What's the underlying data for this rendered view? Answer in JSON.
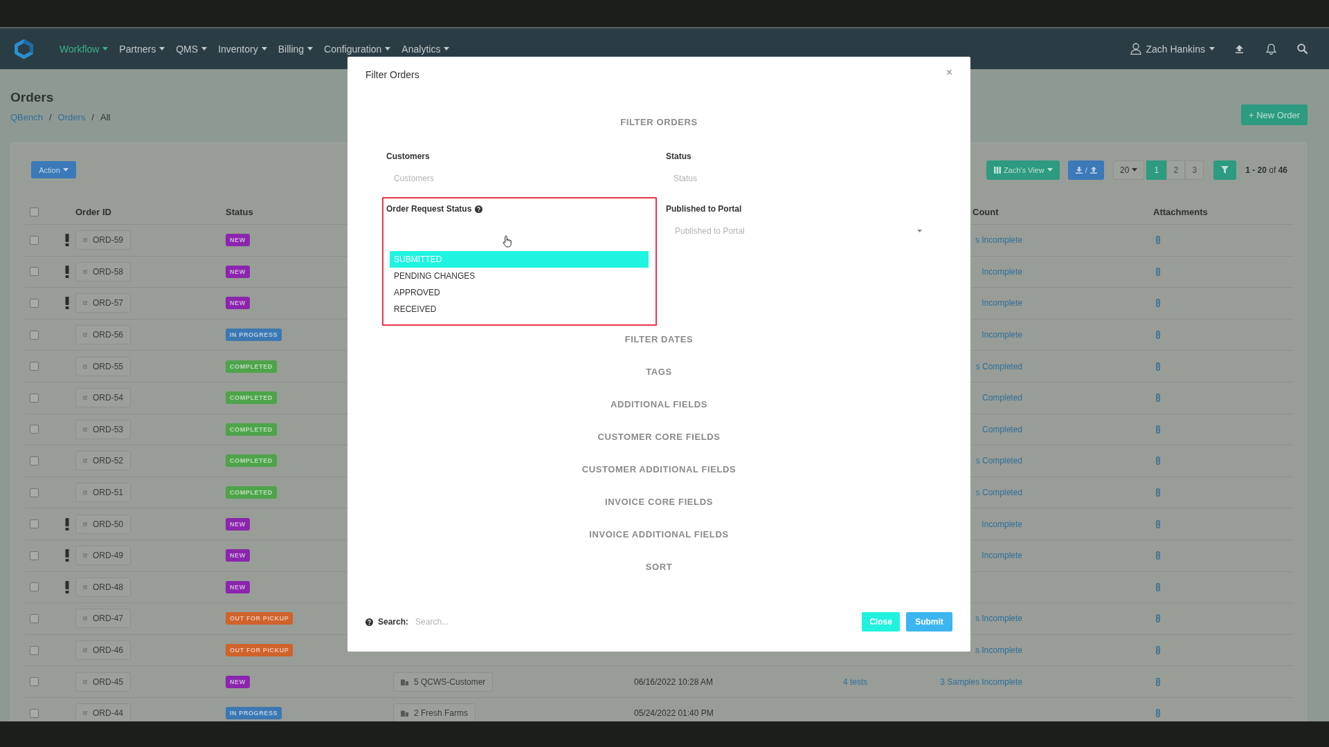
{
  "nav": {
    "items": [
      {
        "label": "Workflow",
        "selected": true
      },
      {
        "label": "Partners",
        "selected": false
      },
      {
        "label": "QMS",
        "selected": false
      },
      {
        "label": "Inventory",
        "selected": false
      },
      {
        "label": "Billing",
        "selected": false
      },
      {
        "label": "Configuration",
        "selected": false
      },
      {
        "label": "Analytics",
        "selected": false
      }
    ],
    "user": "Zach Hankins"
  },
  "header": {
    "title": "Orders",
    "breadcrumb": [
      {
        "kind": "link",
        "label": "QBench"
      },
      {
        "kind": "separator",
        "label": "/"
      },
      {
        "kind": "link",
        "label": "Orders"
      },
      {
        "kind": "separator",
        "label": "/"
      },
      {
        "kind": "current",
        "label": "All"
      }
    ],
    "new_button": "+ New Order"
  },
  "toolbar": {
    "action": "Action",
    "view": "Zach's View",
    "transfer_separator": "/",
    "page_size": "20",
    "pages": [
      {
        "label": "1",
        "selected": true
      },
      {
        "label": "2",
        "selected": false
      },
      {
        "label": "3",
        "selected": false
      }
    ],
    "range": "**1 - 20** of **46**"
  },
  "table": {
    "all_checked": false,
    "columns": [
      "Order ID",
      "Status",
      "Count",
      "Attachments"
    ],
    "rows": [
      {
        "checked": false,
        "priority": true,
        "order_id": "ORD-59",
        "status": {
          "label": "NEW",
          "color": "#8b25ad"
        },
        "samples": "s Incomplete",
        "attachment": true
      },
      {
        "checked": false,
        "priority": true,
        "order_id": "ORD-58",
        "status": {
          "label": "NEW",
          "color": "#8b25ad"
        },
        "samples": "Incomplete",
        "attachment": true
      },
      {
        "checked": false,
        "priority": true,
        "order_id": "ORD-57",
        "status": {
          "label": "NEW",
          "color": "#8b25ad"
        },
        "samples": "Incomplete",
        "attachment": true
      },
      {
        "checked": false,
        "priority": false,
        "order_id": "ORD-56",
        "status": {
          "label": "IN PROGRESS",
          "color": "#3b78b3"
        },
        "samples": "Incomplete",
        "attachment": true
      },
      {
        "checked": false,
        "priority": false,
        "order_id": "ORD-55",
        "status": {
          "label": "COMPLETED",
          "color": "#4ea44a"
        },
        "samples": "s Completed",
        "attachment": true
      },
      {
        "checked": false,
        "priority": false,
        "order_id": "ORD-54",
        "status": {
          "label": "COMPLETED",
          "color": "#4ea44a"
        },
        "samples": "Completed",
        "attachment": true
      },
      {
        "checked": false,
        "priority": false,
        "order_id": "ORD-53",
        "status": {
          "label": "COMPLETED",
          "color": "#4ea44a"
        },
        "samples": "Completed",
        "attachment": true
      },
      {
        "checked": false,
        "priority": false,
        "order_id": "ORD-52",
        "status": {
          "label": "COMPLETED",
          "color": "#4ea44a"
        },
        "samples": "s Completed",
        "attachment": true
      },
      {
        "checked": false,
        "priority": false,
        "order_id": "ORD-51",
        "status": {
          "label": "COMPLETED",
          "color": "#4ea44a"
        },
        "samples": "s Completed",
        "attachment": true
      },
      {
        "checked": false,
        "priority": true,
        "order_id": "ORD-50",
        "status": {
          "label": "NEW",
          "color": "#8b25ad"
        },
        "samples": "Incomplete",
        "attachment": true
      },
      {
        "checked": false,
        "priority": true,
        "order_id": "ORD-49",
        "status": {
          "label": "NEW",
          "color": "#8b25ad"
        },
        "samples": "Incomplete",
        "attachment": true
      },
      {
        "checked": false,
        "priority": true,
        "order_id": "ORD-48",
        "status": {
          "label": "NEW",
          "color": "#8b25ad"
        },
        "attachment": true
      },
      {
        "checked": false,
        "priority": false,
        "order_id": "ORD-47",
        "status": {
          "label": "OUT FOR PICKUP",
          "color": "#d0622b"
        },
        "samples": "s Incomplete",
        "attachment": true
      },
      {
        "checked": false,
        "priority": false,
        "order_id": "ORD-46",
        "status": {
          "label": "OUT FOR PICKUP",
          "color": "#d0622b"
        },
        "samples": "s Incomplete",
        "attachment": true
      },
      {
        "checked": false,
        "priority": false,
        "order_id": "ORD-45",
        "status": {
          "label": "NEW",
          "color": "#8b25ad"
        },
        "customer": "5 QCWS-Customer",
        "date": "06/16/2022 10:28 AM",
        "tests": "4 tests",
        "samples": "3 Samples Incomplete",
        "attachment": true
      },
      {
        "checked": false,
        "priority": false,
        "order_id": "ORD-44",
        "status": {
          "label": "IN PROGRESS",
          "color": "#3b78b3"
        },
        "customer": "2 Fresh Farms",
        "date": "05/24/2022 01:40 PM",
        "attachment": true
      }
    ]
  },
  "modal": {
    "title": "Filter Orders",
    "close": "×",
    "heading": "FILTER ORDERS",
    "fields": [
      {
        "kind": "text",
        "label": "Customers",
        "placeholder": "Customers",
        "help": false,
        "outlined": false
      },
      {
        "kind": "text",
        "label": "Status",
        "placeholder": "Status",
        "help": false,
        "outlined": false
      },
      {
        "kind": "listbox",
        "label": "Order Request Status",
        "help": true,
        "outlined": true,
        "pointer_cursor": true,
        "options": [
          {
            "label": "SUBMITTED",
            "selected": true
          },
          {
            "label": "PENDING CHANGES",
            "selected": false
          },
          {
            "label": "APPROVED",
            "selected": false
          },
          {
            "label": "RECEIVED",
            "selected": false
          }
        ]
      },
      {
        "kind": "select",
        "label": "Published to Portal",
        "placeholder": "Published to Portal",
        "help": false,
        "outlined": false
      }
    ],
    "sections": [
      "FILTER DATES",
      "TAGS",
      "ADDITIONAL FIELDS",
      "CUSTOMER CORE FIELDS",
      "CUSTOMER ADDITIONAL FIELDS",
      "INVOICE CORE FIELDS",
      "INVOICE ADDITIONAL FIELDS",
      "SORT"
    ],
    "search": {
      "help": true,
      "label": "Search:",
      "placeholder": "Search..."
    },
    "buttons": [
      {
        "label": "Close",
        "kind": "secondary"
      },
      {
        "label": "Submit",
        "kind": "primary"
      }
    ]
  }
}
